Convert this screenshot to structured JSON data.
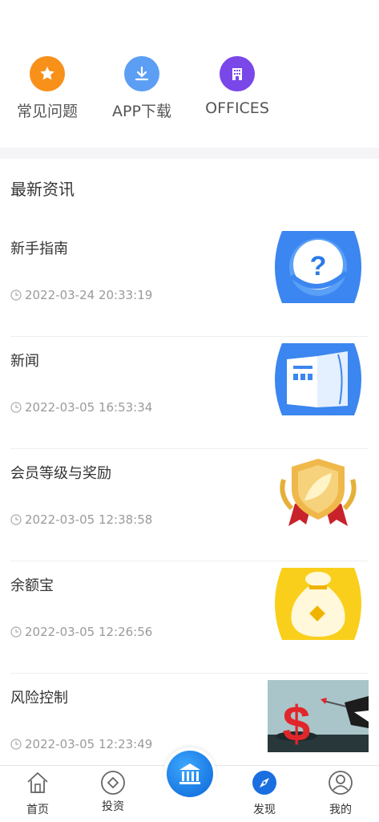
{
  "colors": {
    "accent": "#1a6fe0",
    "faq": "#f7911a",
    "download": "#5b9ef4",
    "offices": "#7a47e8"
  },
  "quick_actions": [
    {
      "label": "常见问题",
      "icon": "star-icon"
    },
    {
      "label": "APP下载",
      "icon": "download-icon"
    },
    {
      "label": "OFFICES",
      "icon": "building-icon"
    }
  ],
  "news": {
    "title": "最新资讯",
    "items": [
      {
        "title": "新手指南",
        "date": "2022-03-24 20:33:19",
        "thumb": "question-icon"
      },
      {
        "title": "新闻",
        "date": "2022-03-05 16:53:34",
        "thumb": "newspaper-icon"
      },
      {
        "title": "会员等级与奖励",
        "date": "2022-03-05 12:38:58",
        "thumb": "shield-badge-icon"
      },
      {
        "title": "余额宝",
        "date": "2022-03-05 12:26:56",
        "thumb": "money-bag-icon"
      },
      {
        "title": "风险控制",
        "date": "2022-03-05 12:23:49",
        "thumb": "dollar-dart-icon"
      }
    ]
  },
  "tabbar": {
    "home": "首页",
    "invest": "投资",
    "discover": "发现",
    "mine": "我的"
  }
}
